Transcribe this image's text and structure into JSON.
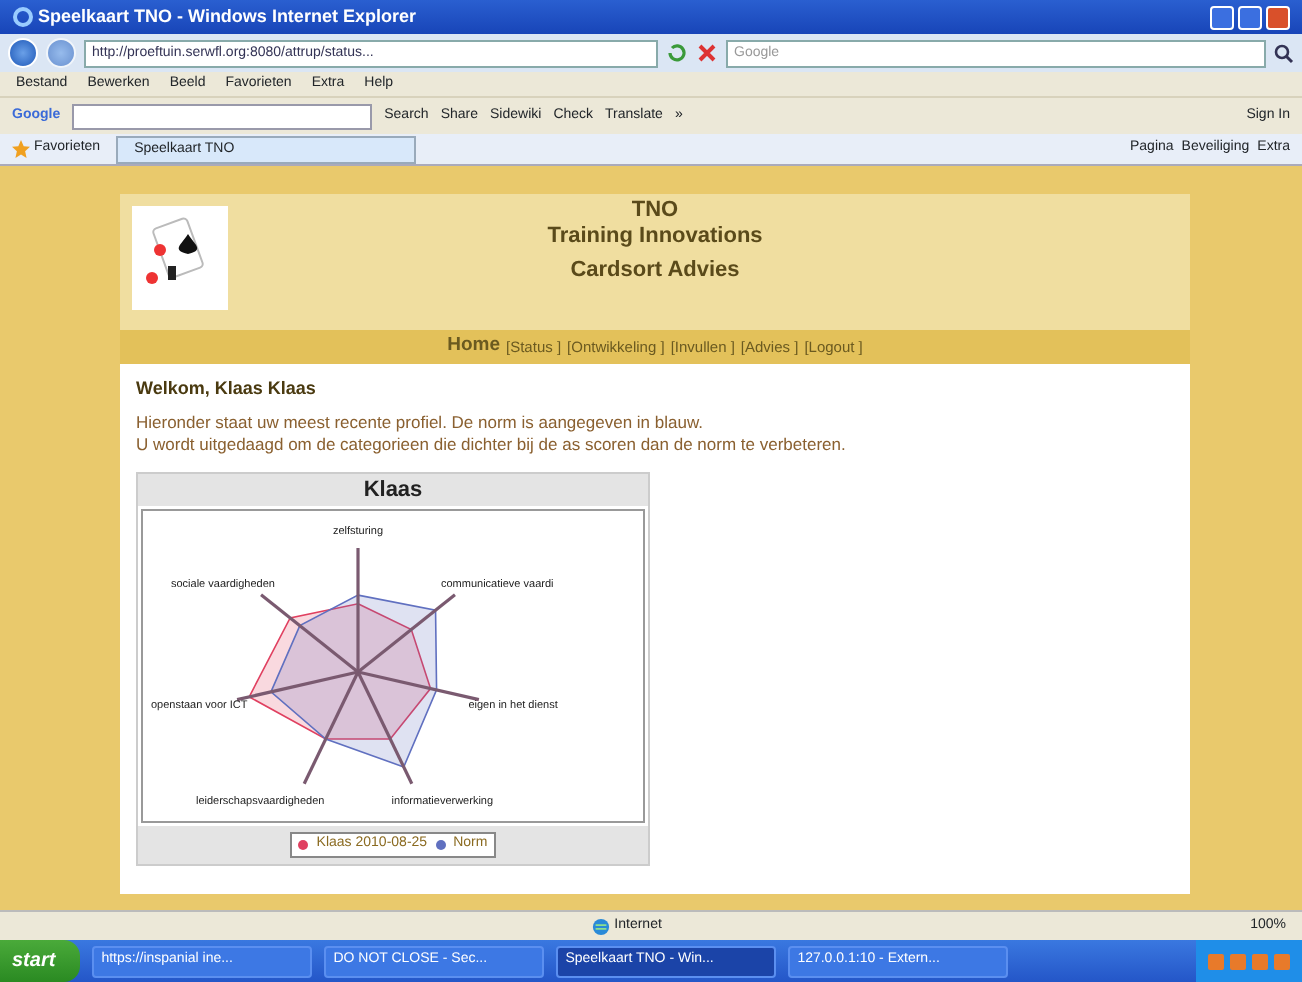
{
  "window": {
    "title": "Speelkaart TNO - Windows Internet Explorer"
  },
  "address_bar": {
    "url": "http://proeftuin.serwfl.org:8080/attrup/status...",
    "search_placeholder": "Google"
  },
  "menu": [
    "Bestand",
    "Bewerken",
    "Beeld",
    "Favorieten",
    "Extra",
    "Help"
  ],
  "google_toolbar": {
    "brand": "Google",
    "buttons": [
      "Search",
      "Share",
      "Sidewiki",
      "Check",
      "Translate"
    ],
    "more": "»",
    "sign_in": "Sign In"
  },
  "favorites_bar": {
    "favorites": "Favorieten",
    "tabs": [
      {
        "label": "Speelkaart TNO",
        "selected": true
      }
    ],
    "commands": [
      "Pagina",
      "Beveiliging",
      "Extra"
    ]
  },
  "page": {
    "org": "TNO",
    "subtitle": "Training Innovations",
    "app": "Cardsort Advies",
    "nav": [
      {
        "label": "Home",
        "selected": true
      },
      {
        "label": "[Status ]",
        "selected": false
      },
      {
        "label": "[Ontwikkeling ]",
        "selected": false
      },
      {
        "label": "[Invullen ]",
        "selected": false
      },
      {
        "label": "[Advies ]",
        "selected": false
      },
      {
        "label": "[Logout ]",
        "selected": false
      }
    ],
    "greeting": "Welkom, Klaas Klaas",
    "intro": [
      "Hieronder staat uw meest recente profiel. De norm is aangegeven in blauw.",
      "U wordt uitgedaagd om de categorieen die dichter bij de as scoren dan de norm te verbeteren."
    ],
    "chart": {
      "title": "Klaas",
      "axes": [
        "zelfsturing",
        "sociale vaardigheden",
        "communicatieve vaardi",
        "openstaan voor ICT",
        "eigen in het dienst",
        "leiderschapsvaardigheden",
        "informatieverwerking"
      ],
      "legend": [
        {
          "label": "Klaas 2010-08-25",
          "color": "#e04060"
        },
        {
          "label": "Norm",
          "color": "#6070c0"
        }
      ]
    }
  },
  "status_bar": {
    "zone": "Internet",
    "zoom": "100%"
  },
  "taskbar": {
    "start": "start",
    "tasks": [
      {
        "label": "https://inspanial ine...",
        "selected": false
      },
      {
        "label": "DO NOT CLOSE - Sec...",
        "selected": false
      },
      {
        "label": "Speelkaart TNO - Win...",
        "selected": true
      },
      {
        "label": "127.0.0.1:10 - Extern...",
        "selected": false
      }
    ]
  }
}
